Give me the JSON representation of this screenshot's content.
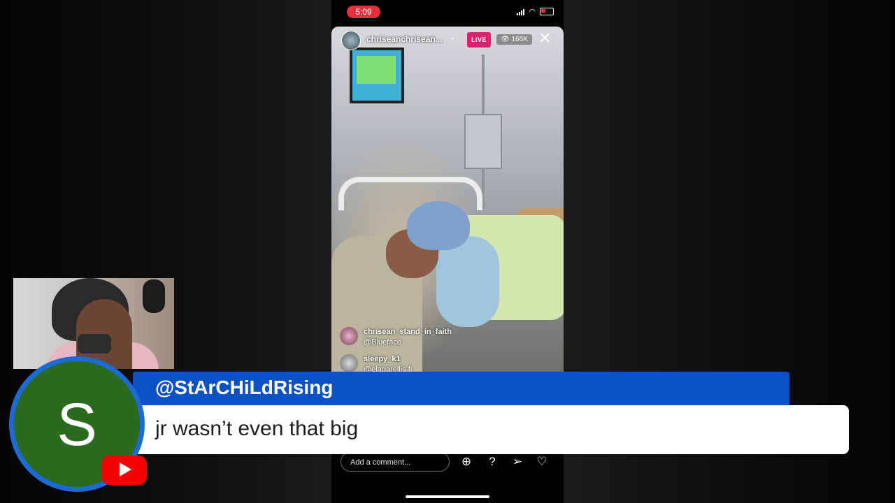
{
  "phone": {
    "status_time": "5:09",
    "live_username": "chriseanchrisean...",
    "live_badge": "LIVE",
    "viewer_count": "166K",
    "close_label": "✕",
    "comments": [
      {
        "user": "chrisean_stand_in_faith",
        "text": "@Blueface"
      },
      {
        "user": "sleepy_k1",
        "text": "@elaparellis.fr"
      }
    ],
    "comment_placeholder": "Add a comment...",
    "icons": [
      "add-icon",
      "question-icon",
      "send-icon",
      "heart-icon"
    ]
  },
  "overlay": {
    "author": "@StArCHiLdRising",
    "message": "jr wasn’t even that big",
    "avatar_letter": "S",
    "brand_color": "#0c52c5",
    "avatar_color": "#2b6b20",
    "badge": "youtube-icon"
  }
}
